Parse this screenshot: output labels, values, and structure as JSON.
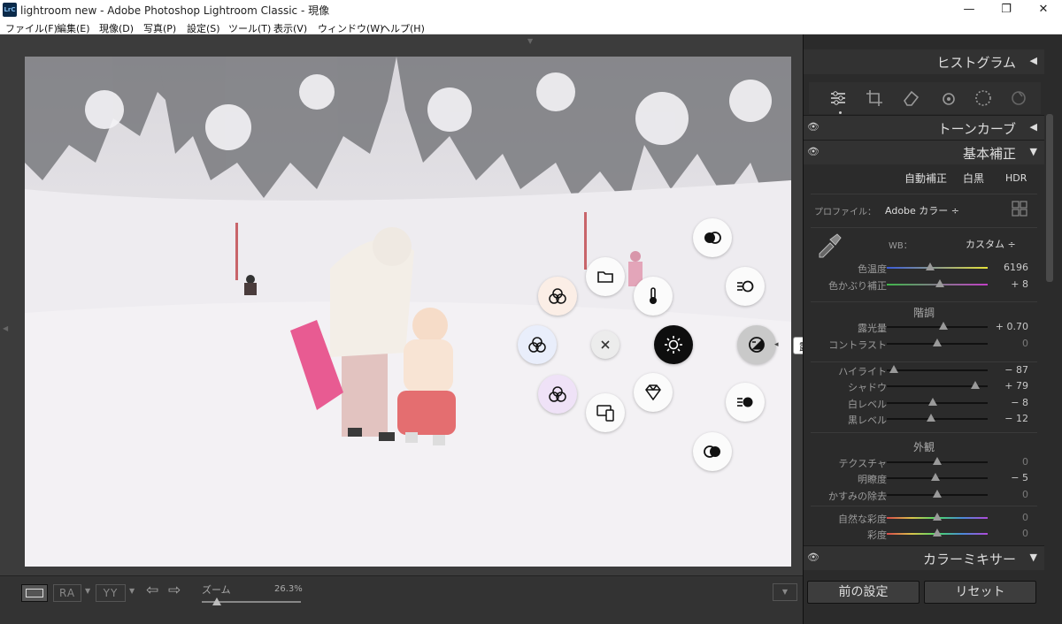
{
  "window": {
    "title": "lightroom new - Adobe Photoshop Lightroom Classic - 現像",
    "app_icon": "LrC",
    "min": "—",
    "max": "❐",
    "close": "✕"
  },
  "menu": [
    "ファイル(F)",
    "編集(E)",
    "現像(D)",
    "写真(P)",
    "設定(S)",
    "ツール(T)",
    "表示(V)",
    "ウィンドウ(W)",
    "ヘルプ(H)"
  ],
  "tooltip": "露光量",
  "toolbar": {
    "ra": "RA",
    "yy": "YY",
    "zoom_label": "ズーム",
    "zoom_value": "26.3%"
  },
  "panel": {
    "histogram": "ヒストグラム",
    "tone_curve": "トーンカーブ",
    "basic": "基本補正",
    "auto": "自動補正",
    "bw": "白黒",
    "hdr": "HDR",
    "profile_label": "プロファイル：",
    "profile_value": "Adobe カラー ÷",
    "wb_label": "WB：",
    "wb_value": "カスタム ÷",
    "tone_section": "階調",
    "presence_section": "外観",
    "color_mixer": "カラーミキサー",
    "previous": "前の設定",
    "reset": "リセット"
  },
  "sliders": [
    {
      "label": "色温度",
      "value": "6196",
      "pos": 0.43,
      "grad": "temp"
    },
    {
      "label": "色かぶり補正",
      "value": "+ 8",
      "pos": 0.53,
      "grad": "tint"
    },
    {
      "label": "露光量",
      "value": "+ 0.70",
      "pos": 0.56
    },
    {
      "label": "コントラスト",
      "value": "0",
      "pos": 0.5,
      "dim": true
    },
    {
      "label": "ハイライト",
      "value": "− 87",
      "pos": 0.07
    },
    {
      "label": "シャドウ",
      "value": "+ 79",
      "pos": 0.88
    },
    {
      "label": "白レベル",
      "value": "− 8",
      "pos": 0.46
    },
    {
      "label": "黒レベル",
      "value": "− 12",
      "pos": 0.44
    },
    {
      "label": "テクスチャ",
      "value": "0",
      "pos": 0.5,
      "dim": true
    },
    {
      "label": "明瞭度",
      "value": "− 5",
      "pos": 0.48
    },
    {
      "label": "かすみの除去",
      "value": "0",
      "pos": 0.5,
      "dim": true
    },
    {
      "label": "自然な彩度",
      "value": "0",
      "pos": 0.5,
      "dim": true,
      "grad": "vib"
    },
    {
      "label": "彩度",
      "value": "0",
      "pos": 0.5,
      "dim": true,
      "grad": "vib"
    }
  ],
  "icons": [
    "sliders-icon",
    "crop-icon",
    "eraser-icon",
    "red-eye-icon",
    "mask-icon",
    "preset-icon"
  ]
}
